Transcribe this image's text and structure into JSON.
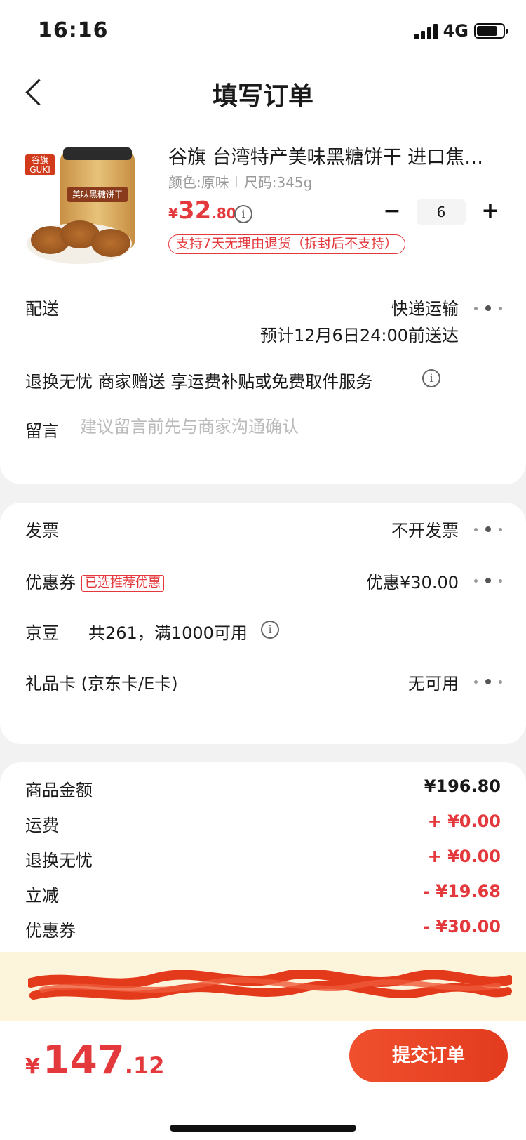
{
  "status_bar": {
    "time": "16:16",
    "network": "4G"
  },
  "nav": {
    "title": "填写订单"
  },
  "product": {
    "title": "谷旗 台湾特产美味黑糖饼干 进口焦糖…",
    "color_spec": "颜色:原味",
    "size_spec": "尺码:345g",
    "price": {
      "currency": "¥",
      "integer": "32",
      "decimal": ".80"
    },
    "quantity": "6",
    "return_badge": "支持7天无理由退货（拆封后不支持）",
    "image_labels": {
      "brand": "谷旗 GUKI",
      "jar_label": "美味黑糖饼干"
    }
  },
  "delivery": {
    "label": "配送",
    "method": "快递运输",
    "eta": "预计12月6日24:00前送达"
  },
  "service": {
    "text": "退换无忧 商家赠送 享运费补贴或免费取件服务"
  },
  "note": {
    "label": "留言",
    "placeholder": "建议留言前先与商家沟通确认"
  },
  "invoice": {
    "label": "发票",
    "value": "不开发票"
  },
  "coupon": {
    "label": "优惠券",
    "tag": "已选推荐优惠",
    "value": "优惠¥30.00"
  },
  "jingdou": {
    "label": "京豆",
    "value": "共261，满1000可用"
  },
  "giftcard": {
    "label": "礼品卡 (京东卡/E卡)",
    "value": "无可用"
  },
  "summary": [
    {
      "label": "商品金额",
      "value": "¥196.80",
      "tone": "normal"
    },
    {
      "label": "运费",
      "value": "+ ¥0.00",
      "tone": "red"
    },
    {
      "label": "退换无忧",
      "value": "+ ¥0.00",
      "tone": "red"
    },
    {
      "label": "立减",
      "value": "- ¥19.68",
      "tone": "red"
    },
    {
      "label": "优惠券",
      "value": "- ¥30.00",
      "tone": "red"
    }
  ],
  "total": {
    "currency": "¥",
    "integer": "147",
    "decimal": ".12"
  },
  "submit_label": "提交订单",
  "colors": {
    "accent": "#e4393c",
    "submit": "#e23b1e",
    "address_bg": "#fdf4dc"
  }
}
